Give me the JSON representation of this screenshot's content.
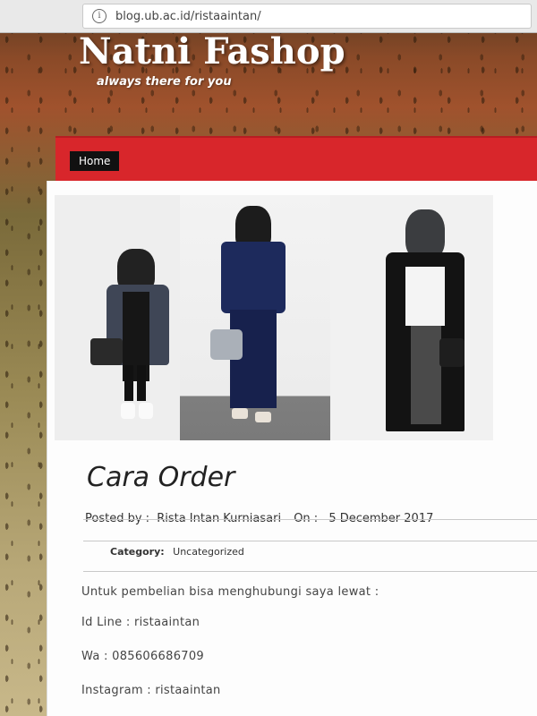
{
  "browser": {
    "url": "blog.ub.ac.id/ristaaintan/"
  },
  "site": {
    "title": "Natni Fashop",
    "tagline": "always there for you"
  },
  "nav": {
    "items": [
      {
        "label": "Home"
      }
    ]
  },
  "banner": {
    "images": [
      "fashion-look-grey-coat",
      "fashion-look-navy-set",
      "fashion-look-black-cardigan"
    ]
  },
  "post": {
    "title": "Cara Order",
    "posted_by_label": "Posted by :",
    "author": "Rista Intan Kurniasari",
    "on_label": "On :",
    "date": "5 December 2017",
    "category_label": "Category:",
    "category": "Uncategorized",
    "body": [
      "Untuk pembelian bisa menghubungi saya lewat :",
      "Id Line : ristaaintan",
      "Wa : 085606686709",
      "Instagram : ristaaintan"
    ]
  },
  "colors": {
    "nav_red": "#d8262b",
    "home_bg": "#111111",
    "title_white": "#ffffff"
  },
  "icons": {
    "url_info": "info-icon"
  }
}
